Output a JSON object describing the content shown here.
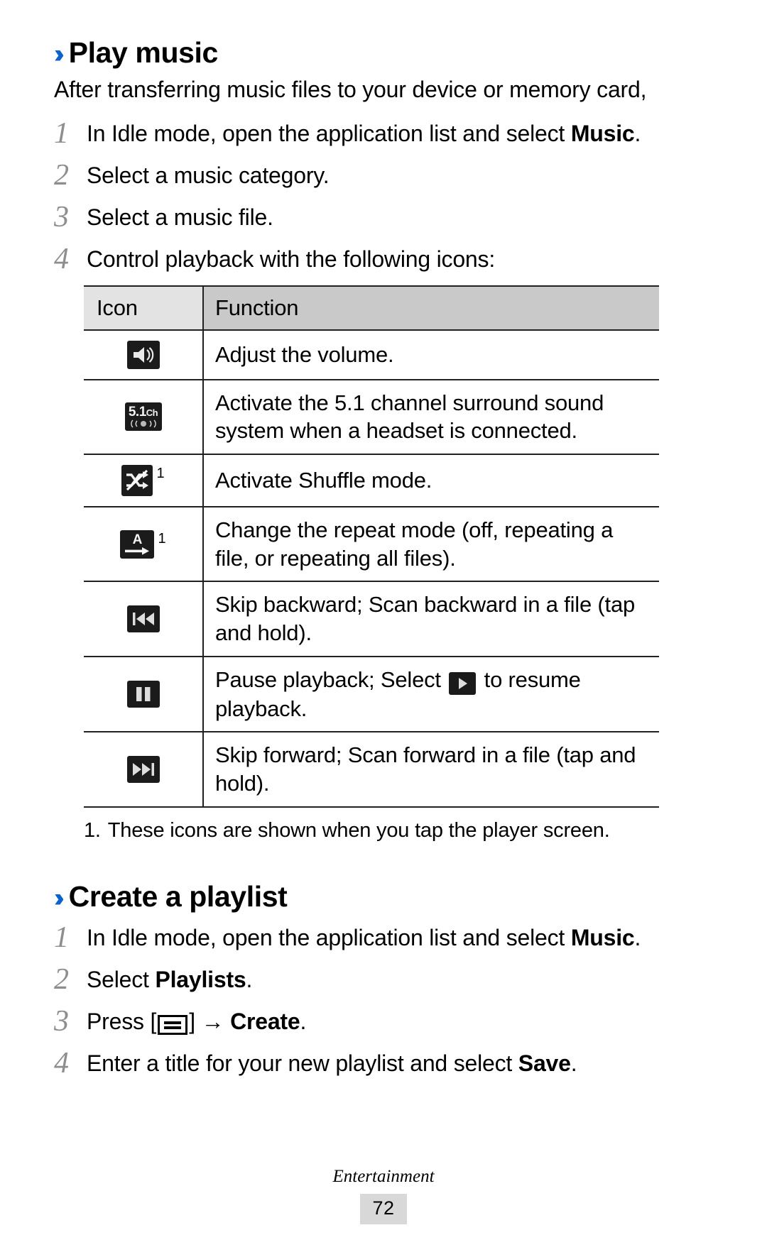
{
  "document": {
    "footer_label": "Entertainment",
    "page_number": "72",
    "accent_color": "#0b63ce",
    "chevron": "››"
  },
  "sections": [
    {
      "heading": "Play music",
      "intro": "After transferring music files to your device or memory card,",
      "steps": [
        {
          "num": "1",
          "text_before": "In Idle mode, open the application list and select ",
          "bold": "Music",
          "text_after": "."
        },
        {
          "num": "2",
          "text_before": "Select a music category.",
          "bold": "",
          "text_after": ""
        },
        {
          "num": "3",
          "text_before": "Select a music file.",
          "bold": "",
          "text_after": ""
        },
        {
          "num": "4",
          "text_before": "Control playback with the following icons:",
          "bold": "",
          "text_after": ""
        }
      ]
    },
    {
      "heading": "Create a playlist",
      "steps": [
        {
          "num": "1",
          "text_before": "In Idle mode, open the application list and select ",
          "bold": "Music",
          "text_after": "."
        },
        {
          "num": "2",
          "text_before": "Select ",
          "bold": "Playlists",
          "text_after": "."
        },
        {
          "num": "3",
          "text_before": "Press ",
          "bold": "",
          "text_after": ""
        },
        {
          "num": "4",
          "text_before": "Enter a title for your new playlist and select ",
          "bold": "Save",
          "text_after": "."
        }
      ],
      "press_step": {
        "prefix": "Press [",
        "suffix": "] → ",
        "bold": "Create",
        "period": "."
      }
    }
  ],
  "icon_table": {
    "headers": {
      "icon": "Icon",
      "function": "Function"
    },
    "rows": [
      {
        "icon_name": "volume-icon",
        "superscript": "",
        "function": "Adjust the volume."
      },
      {
        "icon_name": "surround-5-1-channel-icon",
        "superscript": "",
        "function": "Activate the 5.1 channel surround sound system when a headset is connected."
      },
      {
        "icon_name": "shuffle-icon",
        "superscript": "1",
        "function": "Activate Shuffle mode."
      },
      {
        "icon_name": "repeat-icon",
        "superscript": "1",
        "function": "Change the repeat mode (off, repeating a file, or repeating all files)."
      },
      {
        "icon_name": "skip-backward-icon",
        "superscript": "",
        "function": "Skip backward; Scan backward in a file (tap and hold)."
      },
      {
        "icon_name": "pause-icon",
        "superscript": "",
        "function_before": "Pause playback; Select ",
        "function_after": " to resume playback.",
        "inline_icon": "play-icon"
      },
      {
        "icon_name": "skip-forward-icon",
        "superscript": "",
        "function": "Skip forward; Scan forward in a file (tap and hold)."
      }
    ],
    "footnote_num": "1.",
    "footnote_text": "These icons are shown when you tap the player screen.",
    "glyph_labels": {
      "ch_main": "5.1",
      "ch_suffix": "Ch",
      "repeat_letter": "A"
    }
  }
}
